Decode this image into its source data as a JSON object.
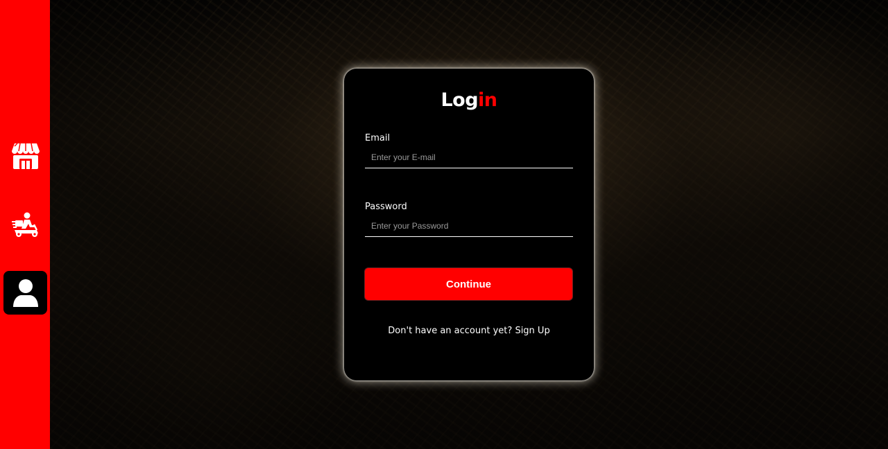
{
  "sidebar": {
    "items": [
      {
        "icon": "store-icon",
        "active": false
      },
      {
        "icon": "delivery-scooter-icon",
        "active": false
      },
      {
        "icon": "user-icon",
        "active": true
      }
    ],
    "accent_color": "#ff0000"
  },
  "login": {
    "title_part1": "Log",
    "title_part2": "in",
    "email_label": "Email",
    "email_placeholder": "Enter your E-mail",
    "email_value": "",
    "password_label": "Password",
    "password_placeholder": "Enter your Password",
    "password_value": "",
    "continue_label": "Continue",
    "signup_prompt": "Don't have an account yet?",
    "signup_link": "Sign Up"
  }
}
